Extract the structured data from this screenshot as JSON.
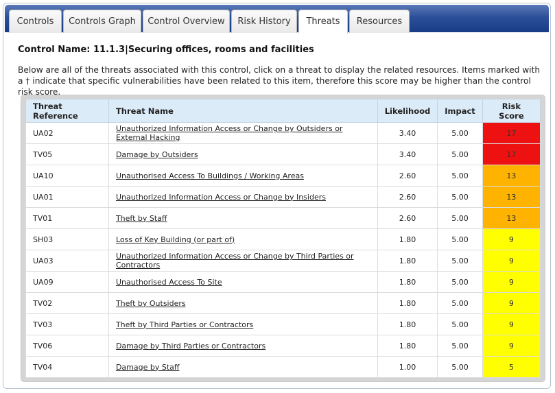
{
  "tabs": [
    {
      "label": "Controls",
      "active": false
    },
    {
      "label": "Controls Graph",
      "active": false
    },
    {
      "label": "Control Overview",
      "active": false
    },
    {
      "label": "Risk History",
      "active": false
    },
    {
      "label": "Threats",
      "active": true
    },
    {
      "label": "Resources",
      "active": false
    }
  ],
  "control": {
    "label": "Control Name: 11.1.3",
    "title": "Securing offices, rooms and facilities"
  },
  "description": "Below are all of the threats associated with this control, click on a threat to display the related resources. Items marked with a † indicate that specific vulnerabilities have been related to this item, therefore this score may be higher than the control risk score.",
  "table": {
    "headers": {
      "ref": "Threat Reference",
      "name": "Threat Name",
      "likelihood": "Likelihood",
      "impact": "Impact",
      "score": "Risk Score"
    },
    "score_colors": {
      "17": "#ee1111",
      "13": "#fdb300",
      "9": "#ffff00",
      "5": "#ffff00"
    },
    "rows": [
      {
        "ref": "UA02",
        "name": "Unauthorized Information Access or Change by Outsiders or External Hacking",
        "likelihood": "3.40",
        "impact": "5.00",
        "score": "17"
      },
      {
        "ref": "TV05",
        "name": "Damage by Outsiders",
        "likelihood": "3.40",
        "impact": "5.00",
        "score": "17"
      },
      {
        "ref": "UA10",
        "name": "Unauthorised Access To Buildings / Working Areas",
        "likelihood": "2.60",
        "impact": "5.00",
        "score": "13"
      },
      {
        "ref": "UA01",
        "name": "Unauthorized Information Access or Change by Insiders",
        "likelihood": "2.60",
        "impact": "5.00",
        "score": "13"
      },
      {
        "ref": "TV01",
        "name": "Theft by Staff",
        "likelihood": "2.60",
        "impact": "5.00",
        "score": "13"
      },
      {
        "ref": "SH03",
        "name": "Loss of Key Building (or part of)",
        "likelihood": "1.80",
        "impact": "5.00",
        "score": "9"
      },
      {
        "ref": "UA03",
        "name": "Unauthorized Information Access or Change by Third Parties or Contractors",
        "likelihood": "1.80",
        "impact": "5.00",
        "score": "9"
      },
      {
        "ref": "UA09",
        "name": "Unauthorised Access To Site",
        "likelihood": "1.80",
        "impact": "5.00",
        "score": "9"
      },
      {
        "ref": "TV02",
        "name": "Theft by Outsiders",
        "likelihood": "1.80",
        "impact": "5.00",
        "score": "9"
      },
      {
        "ref": "TV03",
        "name": "Theft by Third Parties or Contractors",
        "likelihood": "1.80",
        "impact": "5.00",
        "score": "9"
      },
      {
        "ref": "TV06",
        "name": "Damage by Third Parties or Contractors",
        "likelihood": "1.80",
        "impact": "5.00",
        "score": "9"
      },
      {
        "ref": "TV04",
        "name": "Damage by Staff",
        "likelihood": "1.00",
        "impact": "5.00",
        "score": "5"
      }
    ]
  }
}
